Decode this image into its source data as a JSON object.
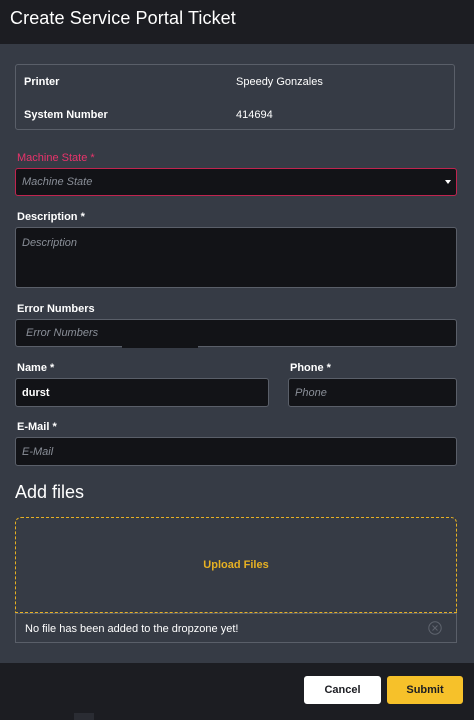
{
  "header": {
    "title": "Create Service Portal Ticket"
  },
  "info": {
    "printer_label": "Printer",
    "printer_value": "Speedy Gonzales",
    "system_label": "System Number",
    "system_value": "414694"
  },
  "form": {
    "machine_state": {
      "label": "Machine State *",
      "placeholder": "Machine State"
    },
    "description": {
      "label": "Description *",
      "placeholder": "Description"
    },
    "error_numbers": {
      "label": "Error Numbers",
      "placeholder": "Error Numbers"
    },
    "name": {
      "label": "Name *",
      "value": "durst"
    },
    "phone": {
      "label": "Phone *",
      "placeholder": "Phone"
    },
    "email": {
      "label": "E-Mail *",
      "placeholder": "E-Mail"
    }
  },
  "files": {
    "title": "Add files",
    "upload_label": "Upload Files",
    "empty_message": "No file has been added to the dropzone yet!"
  },
  "footer": {
    "cancel_label": "Cancel",
    "submit_label": "Submit"
  },
  "colors": {
    "accent": "#f6c12a",
    "error": "#e8336b",
    "panel": "#363b45",
    "field": "#121317"
  }
}
